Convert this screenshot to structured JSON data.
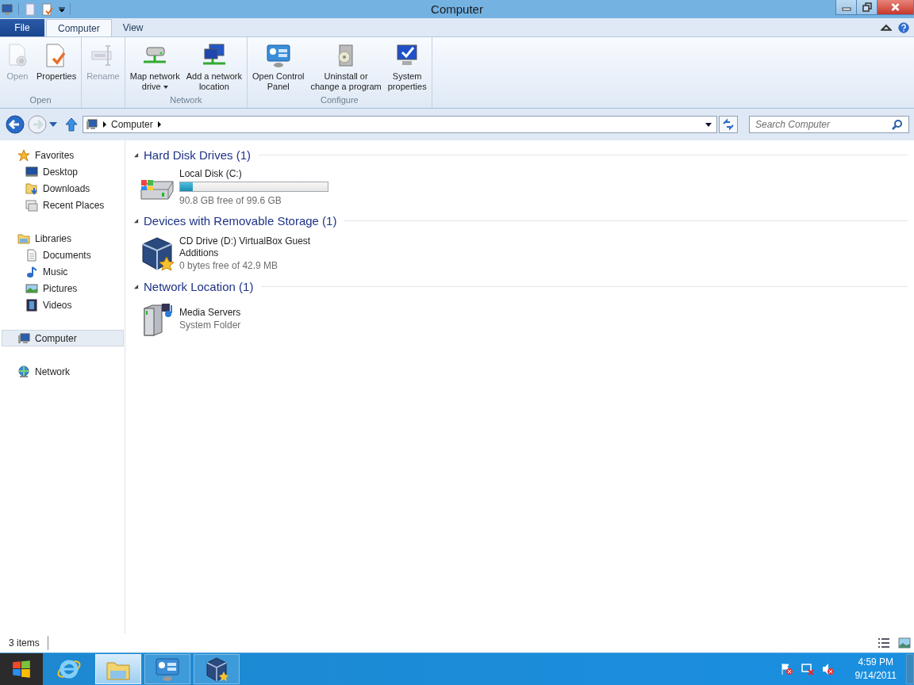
{
  "window": {
    "title": "Computer"
  },
  "ribbon": {
    "tabs": [
      {
        "label": "File",
        "kind": "file",
        "selected": false
      },
      {
        "label": "Computer",
        "kind": "tab",
        "selected": true
      },
      {
        "label": "View",
        "kind": "tab",
        "selected": false
      }
    ],
    "groups": [
      {
        "label": "Open",
        "buttons": [
          {
            "lines": [
              "Open"
            ],
            "kind": "open",
            "disabled": true,
            "dropdown": false
          },
          {
            "lines": [
              "Properties"
            ],
            "kind": "properties",
            "disabled": false,
            "dropdown": false
          }
        ]
      },
      {
        "buttons": [
          {
            "lines": [
              "Rename"
            ],
            "kind": "rename",
            "disabled": true,
            "dropdown": false
          }
        ]
      },
      {
        "label": "Network",
        "buttons": [
          {
            "lines": [
              "Map network",
              "drive"
            ],
            "kind": "mapdrive",
            "disabled": false,
            "dropdown": true
          },
          {
            "lines": [
              "Add a network",
              "location"
            ],
            "kind": "netloc",
            "disabled": false,
            "dropdown": false
          }
        ]
      },
      {
        "label": "Configure",
        "buttons": [
          {
            "lines": [
              "Open Control",
              "Panel"
            ],
            "kind": "control",
            "disabled": false,
            "dropdown": false
          },
          {
            "lines": [
              "Uninstall or",
              "change a program"
            ],
            "kind": "uninstall",
            "disabled": false,
            "dropdown": false
          },
          {
            "lines": [
              "System",
              "properties"
            ],
            "kind": "system",
            "disabled": false,
            "dropdown": false
          }
        ]
      }
    ]
  },
  "address": {
    "crumbs": [
      "Computer"
    ],
    "search_placeholder": "Search Computer"
  },
  "sidebar": [
    {
      "label": "Favorites",
      "kind": "star",
      "selected": false,
      "children": [
        {
          "label": "Desktop",
          "kind": "desktop"
        },
        {
          "label": "Downloads",
          "kind": "downloads"
        },
        {
          "label": "Recent Places",
          "kind": "recent"
        }
      ]
    },
    {
      "label": "Libraries",
      "kind": "folder",
      "selected": false,
      "children": [
        {
          "label": "Documents",
          "kind": "doc"
        },
        {
          "label": "Music",
          "kind": "music"
        },
        {
          "label": "Pictures",
          "kind": "picture"
        },
        {
          "label": "Videos",
          "kind": "video"
        }
      ]
    },
    {
      "label": "Computer",
      "kind": "computer",
      "selected": true
    },
    {
      "label": "Network",
      "kind": "network",
      "selected": false
    }
  ],
  "sections": [
    {
      "title": "Hard Disk Drives (1)",
      "expanded": true,
      "items": [
        {
          "kind": "disk",
          "name": "Local Disk (C:)",
          "level": 0.088,
          "detail": "90.8 GB free of 99.6 GB"
        }
      ]
    },
    {
      "title": "Devices with Removable Storage (1)",
      "expanded": true,
      "items": [
        {
          "kind": "cd",
          "name": "CD Drive (D:) VirtualBox Guest Additions",
          "detail": "0 bytes free of 42.9 MB"
        }
      ]
    },
    {
      "title": "Network Location (1)",
      "expanded": true,
      "items": [
        {
          "kind": "media",
          "name": "Media Servers",
          "detail": "System Folder"
        }
      ]
    }
  ],
  "status_bar": {
    "count": "3 items"
  },
  "taskbar": {
    "apps": [
      {
        "kind": "ie",
        "selected": false
      },
      {
        "kind": "explorer",
        "selected": true
      },
      {
        "kind": "control",
        "selected": false
      },
      {
        "kind": "vbox",
        "selected": false
      }
    ],
    "time": "4:59 PM",
    "date": "9/14/2011"
  }
}
